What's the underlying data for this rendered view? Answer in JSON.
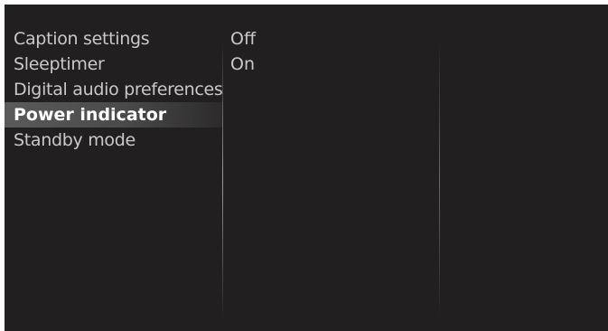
{
  "menu": {
    "items": [
      {
        "label": "Caption settings"
      },
      {
        "label": "Sleeptimer"
      },
      {
        "label": "Digital audio preferences"
      },
      {
        "label": "Power indicator",
        "selected": true
      },
      {
        "label": "Standby mode"
      }
    ]
  },
  "options": {
    "items": [
      {
        "label": "Off"
      },
      {
        "label": "On"
      }
    ]
  },
  "colors": {
    "background": "#221f20",
    "text": "#c9c9c9",
    "selected_text": "#ffffff",
    "highlight": "#5a5a5a"
  }
}
